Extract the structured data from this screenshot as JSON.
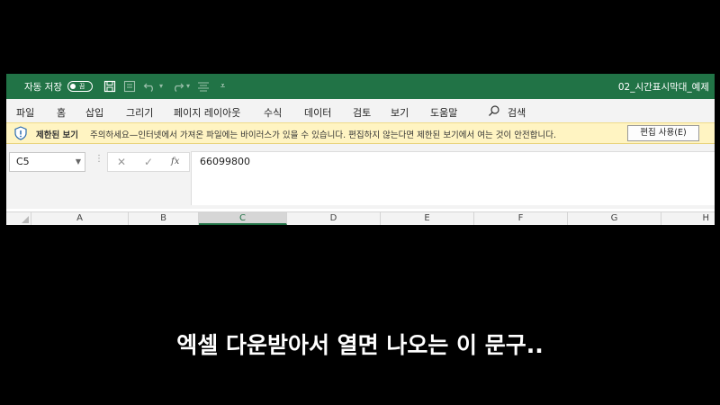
{
  "titlebar": {
    "autosave_label": "자동 저장",
    "autosave_state": "끔",
    "document_title": "02_시간표시막대_예제",
    "accent_color": "#217346",
    "icons": [
      "save-icon",
      "touch-mode-icon",
      "undo-icon",
      "redo-icon",
      "form-icon",
      "customize-icon"
    ]
  },
  "ribbon": {
    "tabs": [
      "파일",
      "홈",
      "삽입",
      "그리기",
      "페이지 레이아웃",
      "수식",
      "데이터",
      "검토",
      "보기",
      "도움말"
    ],
    "search_label": "검색"
  },
  "protected_view": {
    "title": "제한된 보기",
    "message": "주의하세요—인터넷에서 가져온 파일에는 바이러스가 있을 수 있습니다. 편집하지 않는다면 제한된 보기에서 여는 것이 안전합니다.",
    "enable_button": "편집 사용(E)",
    "bar_color": "#fff4c2"
  },
  "formula_bar": {
    "name_box": "C5",
    "cancel_symbol": "✕",
    "enter_symbol": "✓",
    "fx_label": "fx",
    "value": "66099800"
  },
  "columns": [
    "A",
    "B",
    "C",
    "D",
    "E",
    "F",
    "G",
    "H"
  ],
  "active_column": "C",
  "caption": "엑셀 다운받아서 열면 나오는 이 문구.."
}
